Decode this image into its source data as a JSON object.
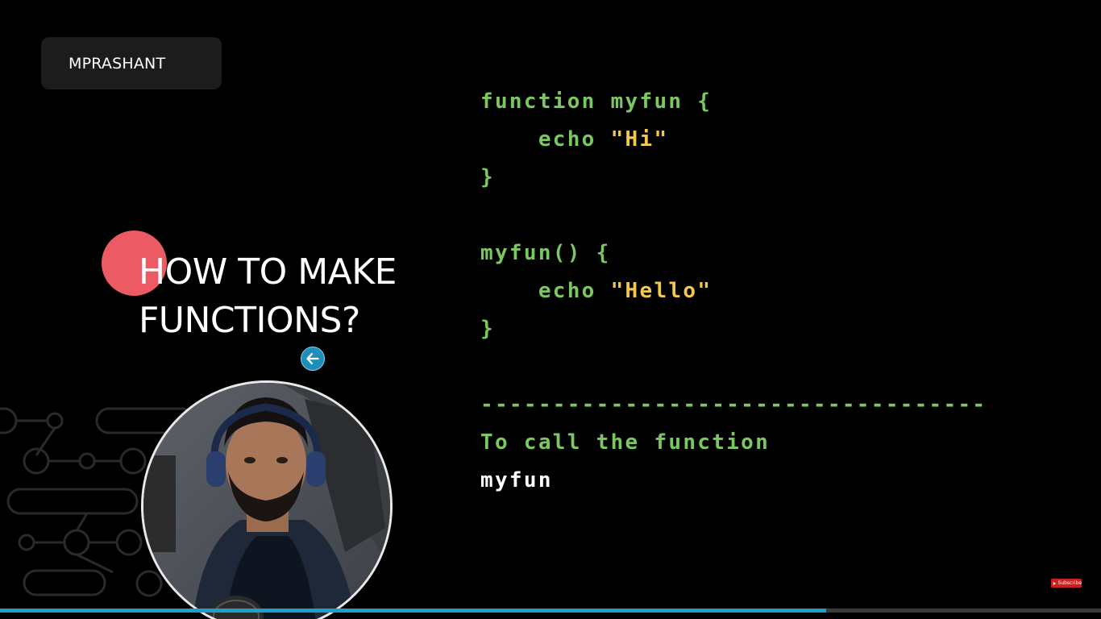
{
  "brand": {
    "name": "MPRASHANT"
  },
  "title": {
    "line1": "HOW TO MAKE",
    "line2": "FUNCTIONS?"
  },
  "code": {
    "lines": [
      [
        {
          "t": "function myfun {",
          "c": "kw"
        }
      ],
      [
        {
          "t": "    echo ",
          "c": "kw"
        },
        {
          "t": "\"Hi\"",
          "c": "str"
        }
      ],
      [
        {
          "t": "}",
          "c": "kw"
        }
      ],
      [],
      [
        {
          "t": "myfun() {",
          "c": "kw"
        }
      ],
      [
        {
          "t": "    echo ",
          "c": "kw"
        },
        {
          "t": "\"Hello\"",
          "c": "str"
        }
      ],
      [
        {
          "t": "}",
          "c": "kw"
        }
      ],
      [],
      [
        {
          "t": "-----------------------------------",
          "c": "kw"
        }
      ],
      [
        {
          "t": "To call the function",
          "c": "kw"
        }
      ],
      [
        {
          "t": "myfun",
          "c": "plain"
        }
      ]
    ]
  },
  "subscribe": {
    "label": "Subscribe"
  },
  "video": {
    "progress_fraction": 0.75
  },
  "colors": {
    "background": "#000000",
    "keyword": "#7bc862",
    "string": "#f2c94c",
    "accent_red": "#ec5a64",
    "progress": "#1aa0c9"
  },
  "icons": {
    "cursor": "back-arrow-icon",
    "decoration": "circuit-pattern",
    "presenter": "presenter-webcam"
  }
}
